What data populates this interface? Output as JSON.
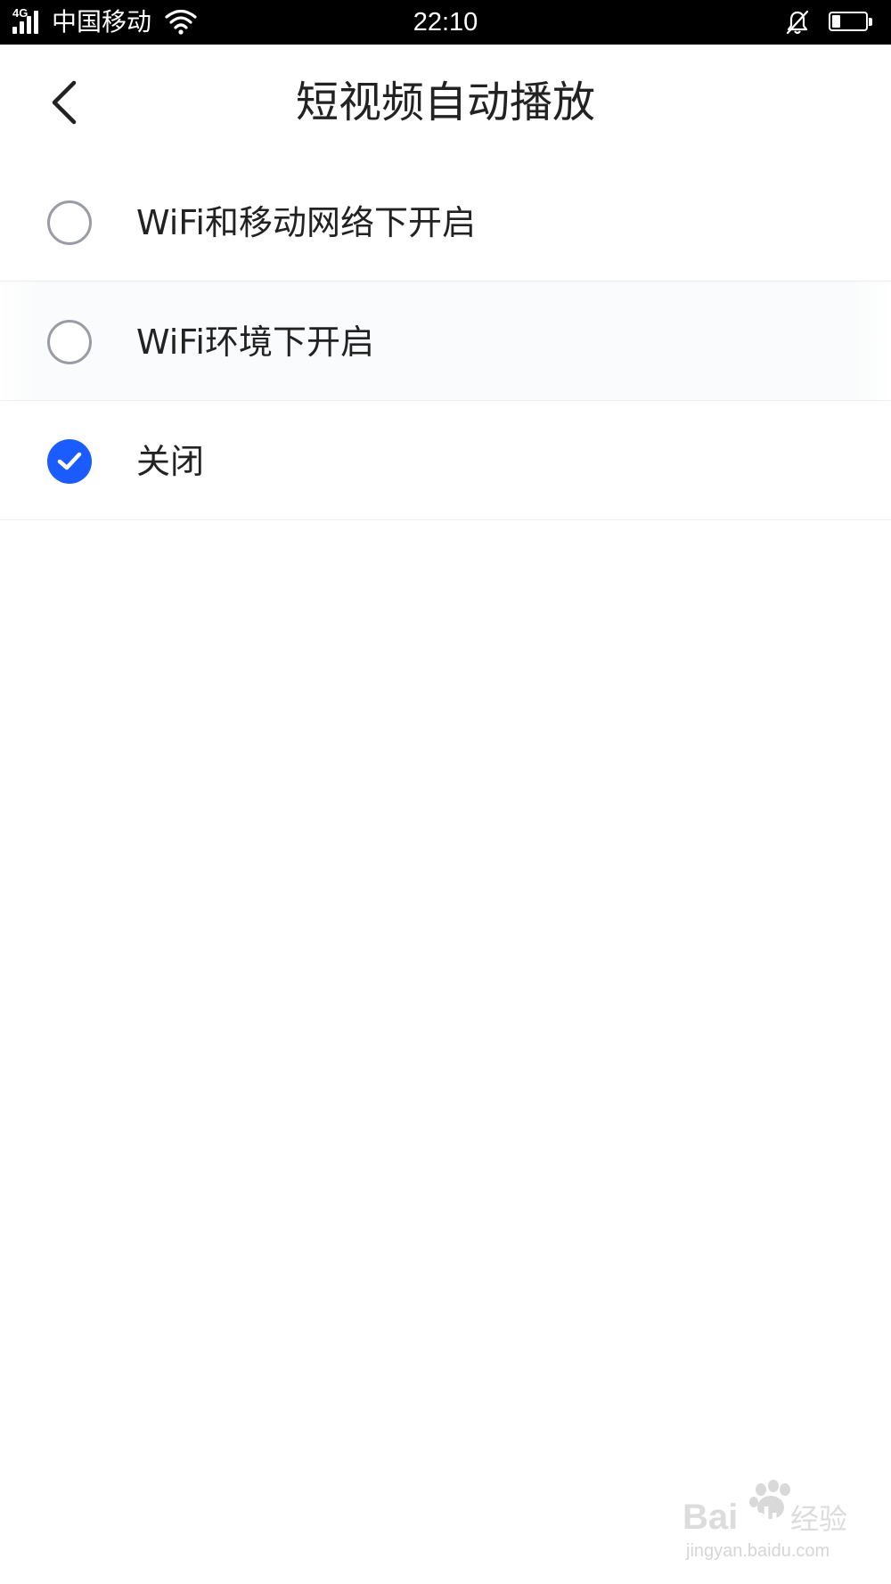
{
  "status_bar": {
    "network_type": "4G",
    "carrier": "中国移动",
    "time": "22:10",
    "battery_level_fraction": 0.25,
    "icons": [
      "signal-icon",
      "wifi-icon",
      "mute-bell-icon",
      "battery-icon"
    ]
  },
  "header": {
    "title": "短视频自动播放",
    "back_icon": "chevron-left-icon"
  },
  "options": {
    "items": [
      {
        "label": "WiFi和移动网络下开启",
        "selected": false
      },
      {
        "label": "WiFi环境下开启",
        "selected": false
      },
      {
        "label": "关闭",
        "selected": true
      }
    ]
  },
  "watermark": {
    "logo": "Baidu经验",
    "url": "jingyan.baidu.com"
  },
  "colors": {
    "accent": "#1a5cff",
    "radio_off": "#9a9ca5",
    "text": "#222222",
    "divider": "#eeeef0",
    "status_bar_bg": "#000000"
  }
}
